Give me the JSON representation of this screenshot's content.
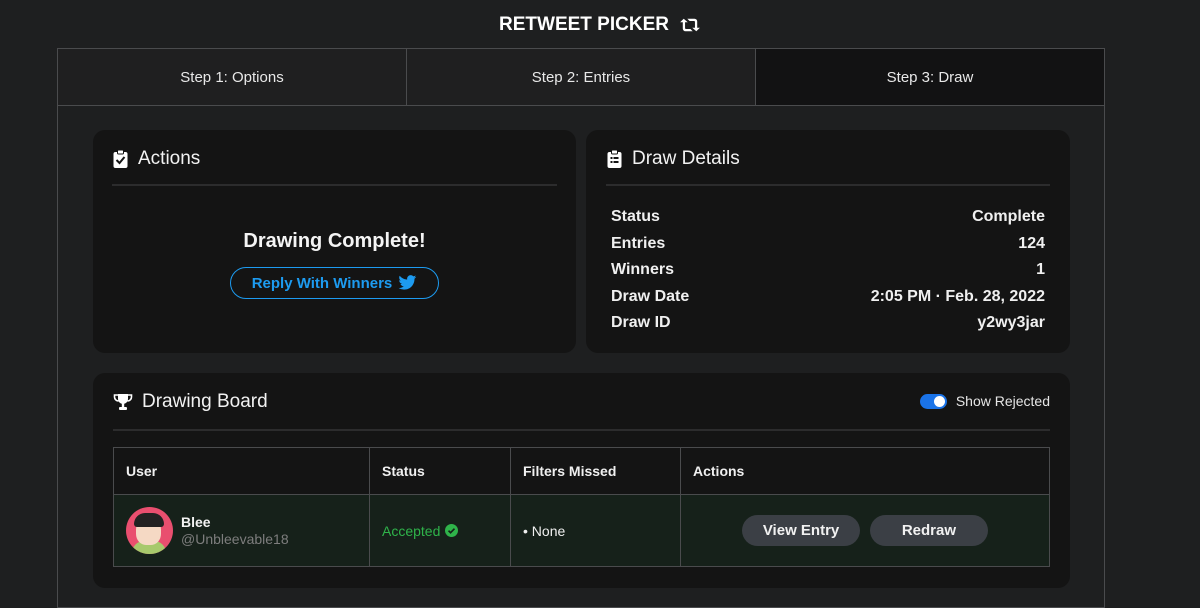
{
  "app": {
    "title": "RETWEET PICKER",
    "title_icon": "retweet-icon"
  },
  "steps": [
    {
      "label": "Step 1: Options",
      "active": false
    },
    {
      "label": "Step 2: Entries",
      "active": false
    },
    {
      "label": "Step 3: Draw",
      "active": true
    }
  ],
  "actions": {
    "title": "Actions",
    "icon": "clipboard-check-icon",
    "status_title": "Drawing Complete!",
    "reply_button": "Reply With Winners",
    "reply_icon": "twitter-icon"
  },
  "details": {
    "title": "Draw Details",
    "icon": "clipboard-list-icon",
    "rows": [
      {
        "label": "Status",
        "value": "Complete"
      },
      {
        "label": "Entries",
        "value": "124"
      },
      {
        "label": "Winners",
        "value": "1"
      },
      {
        "label": "Draw Date",
        "value": "2:05 PM · Feb. 28, 2022"
      },
      {
        "label": "Draw ID",
        "value": "y2wy3jar"
      }
    ]
  },
  "board": {
    "title": "Drawing Board",
    "icon": "trophy-icon",
    "toggle_label": "Show Rejected",
    "toggle_on": true,
    "columns": [
      "User",
      "Status",
      "Filters Missed",
      "Actions"
    ],
    "rows": [
      {
        "name": "Blee",
        "handle": "@Unbleevable18",
        "status": "Accepted",
        "filters_missed": "• None",
        "view_label": "View Entry",
        "redraw_label": "Redraw"
      }
    ]
  },
  "colors": {
    "accent_blue": "#1d9bf0",
    "accepted_green": "#2fb34a",
    "toggle_blue": "#1a73e8",
    "background": "#1e1f20",
    "card": "#141414"
  }
}
